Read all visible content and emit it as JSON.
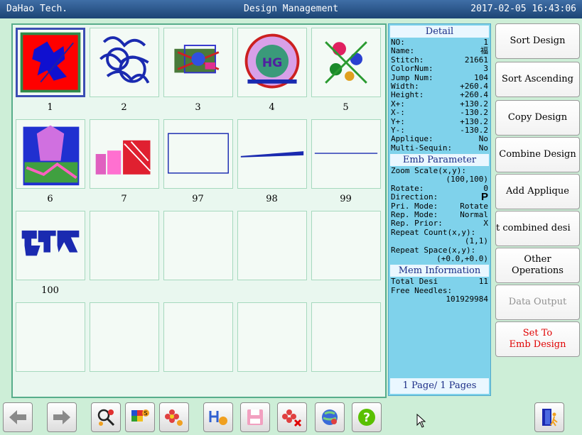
{
  "titlebar": {
    "left": "DaHao Tech.",
    "center": "Design Management",
    "right": "2017-02-05 16:43:06"
  },
  "designs": [
    {
      "label": "1"
    },
    {
      "label": "2"
    },
    {
      "label": "3"
    },
    {
      "label": "4"
    },
    {
      "label": "5"
    },
    {
      "label": "6"
    },
    {
      "label": "7"
    },
    {
      "label": "97"
    },
    {
      "label": "98"
    },
    {
      "label": "99"
    },
    {
      "label": "100"
    }
  ],
  "detail": {
    "title": "Detail",
    "rows": [
      {
        "k": "NO:",
        "v": "1"
      },
      {
        "k": "Name:",
        "v": "福"
      },
      {
        "k": "Stitch:",
        "v": "21661"
      },
      {
        "k": "ColorNum:",
        "v": "3"
      },
      {
        "k": "Jump Num:",
        "v": "104"
      },
      {
        "k": "Width:",
        "v": "+260.4"
      },
      {
        "k": "Height:",
        "v": "+260.4"
      },
      {
        "k": "X+:",
        "v": "+130.2"
      },
      {
        "k": "X-:",
        "v": "-130.2"
      },
      {
        "k": "Y+:",
        "v": "+130.2"
      },
      {
        "k": "Y-:",
        "v": "-130.2"
      },
      {
        "k": "Applique:",
        "v": "No"
      },
      {
        "k": "Multi-Sequin:",
        "v": "No"
      }
    ],
    "emb_title": "Emb Parameter",
    "zoom_label": "Zoom Scale(x,y):",
    "zoom_value": "(100,100)",
    "rotate_label": "Rotate:",
    "rotate_value": "0",
    "direction_label": "Direction:",
    "direction_value": "P",
    "pri_label": "Pri. Mode:",
    "pri_value": "Rotate",
    "rep_label": "Rep. Mode:",
    "rep_value": "Normal",
    "prior_label": "Rep. Prior:",
    "prior_value": "X",
    "repeat_count_label": "Repeat Count(x,y):",
    "repeat_count_value": "(1,1)",
    "repeat_space_label": "Repeat Space(x,y):",
    "repeat_space_value": "(+0.0,+0.0)",
    "mem_title": "Mem Information",
    "total_label": "Total Desi",
    "total_value": "11",
    "free_label": "Free Needles:",
    "free_value": "101929984",
    "pages": "1 Page/ 1 Pages"
  },
  "side_buttons": {
    "sort_design": "Sort Design",
    "sort_ascending": "Sort Ascending",
    "copy_design": "Copy Design",
    "combine_design": "Combine Design",
    "add_applique": "Add Applique",
    "combined": "t combined desi",
    "other": "Other\nOperations",
    "data_output": "Data Output",
    "set_emb": "Set To\nEmb Design"
  },
  "toolbar_icons": [
    "arrow-left-icon",
    "arrow-right-icon",
    "search-design-icon",
    "color-grid-icon",
    "flower-settings-icon",
    "applique-icon",
    "save-disk-icon",
    "delete-flower-icon",
    "network-icon",
    "help-icon",
    "exit-door-icon"
  ],
  "colors": {
    "title_bar": "#1c4474",
    "panel_border": "#58ad8b",
    "detail_bg": "#7fd2eb",
    "accent_red": "#e00000"
  }
}
